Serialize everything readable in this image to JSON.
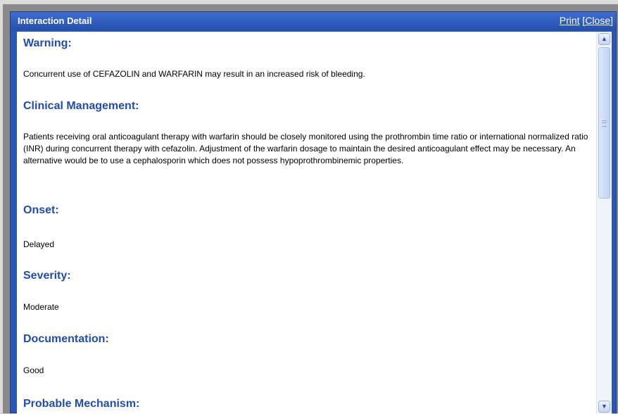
{
  "dialog": {
    "title": "Interaction Detail",
    "links": {
      "print": "Print",
      "close": "Close",
      "open_bracket": "[",
      "close_bracket": "]"
    }
  },
  "sections": {
    "warning": {
      "heading": "Warning:",
      "text": "Concurrent use of CEFAZOLIN and WARFARIN may result in an increased risk of bleeding."
    },
    "clinical_management": {
      "heading": "Clinical Management:",
      "text": "Patients receiving oral anticoagulant therapy with warfarin should be closely monitored using the prothrombin time ratio or international normalized ratio (INR) during concurrent therapy with cefazolin. Adjustment of the warfarin dosage to maintain the desired anticoagulant effect may be necessary. An alternative would be to use a cephalosporin which does not possess hypoprothrombinemic properties."
    },
    "onset": {
      "heading": "Onset:",
      "text": "Delayed"
    },
    "severity": {
      "heading": "Severity:",
      "text": "Moderate"
    },
    "documentation": {
      "heading": "Documentation:",
      "text": "Good"
    },
    "probable_mechanism": {
      "heading": "Probable Mechanism:"
    }
  },
  "scrollbar": {
    "up_icon": "arrow-up-icon",
    "down_icon": "arrow-down-icon"
  }
}
